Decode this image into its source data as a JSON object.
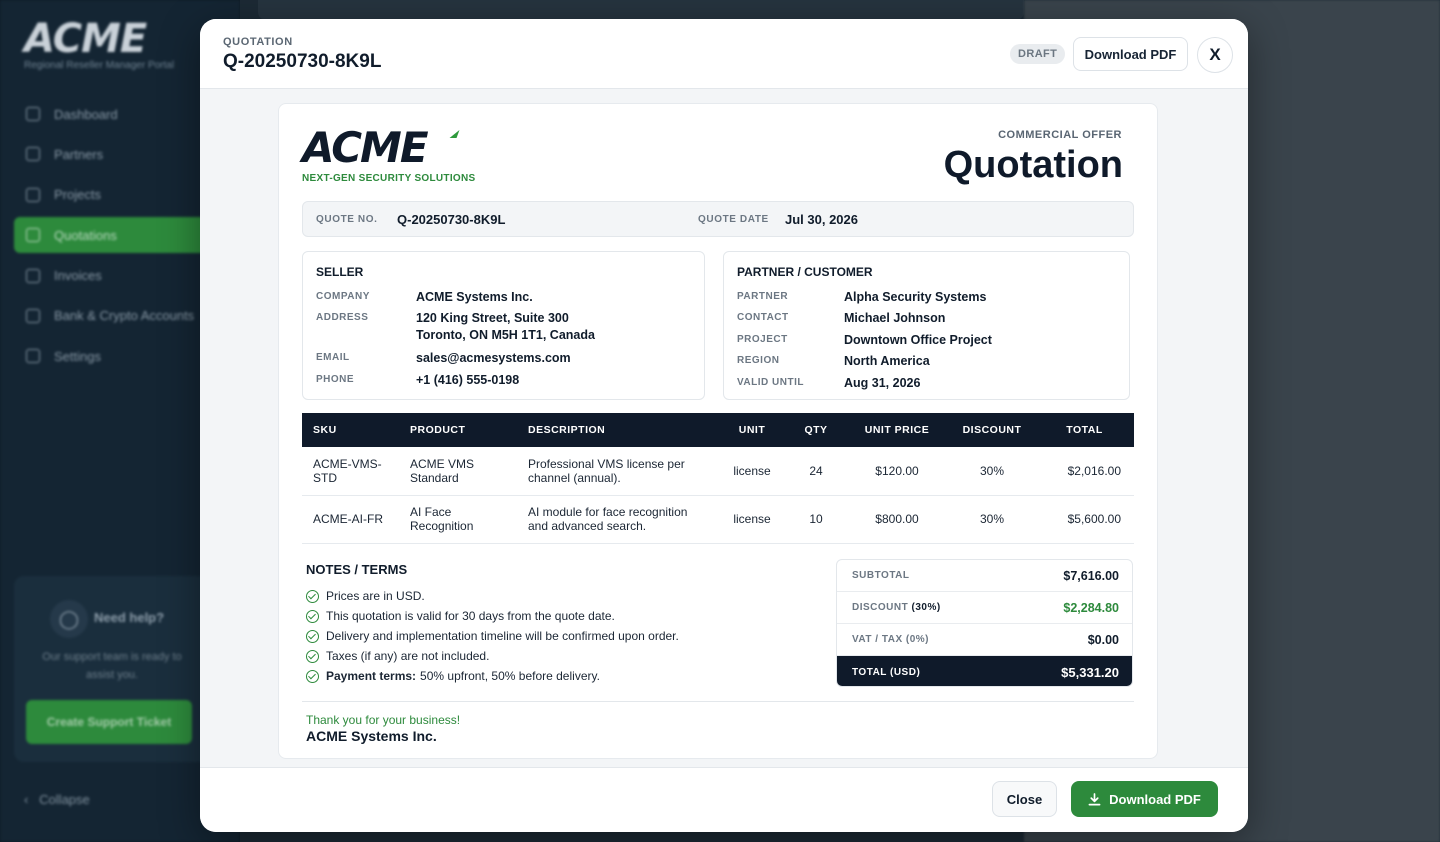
{
  "app": {
    "brand": "ACME",
    "subtitle": "Regional Reseller Manager Portal",
    "nav": [
      {
        "label": "Dashboard",
        "icon": "home-icon"
      },
      {
        "label": "Partners",
        "icon": "users-icon"
      },
      {
        "label": "Projects",
        "icon": "folder-icon"
      },
      {
        "label": "Quotations",
        "icon": "document-icon",
        "active": true
      },
      {
        "label": "Invoices",
        "icon": "invoice-icon"
      },
      {
        "label": "Bank & Crypto Accounts",
        "icon": "bank-icon"
      },
      {
        "label": "Settings",
        "icon": "gear-icon"
      }
    ],
    "help": {
      "title": "Need help?",
      "text": "Our support team is ready to assist you.",
      "button": "Create Support Ticket"
    },
    "collapse": "Collapse"
  },
  "modal": {
    "kicker": "QUOTATION",
    "title": "Q-20250730-8K9L",
    "status": "DRAFT",
    "download_label": "Download PDF",
    "close_x": "X",
    "footer": {
      "close_label": "Close",
      "download_label": "Download PDF"
    }
  },
  "doc": {
    "brand": "ACME",
    "tagline": "NEXT-GEN SECURITY SOLUTIONS",
    "offer_kicker": "COMMERCIAL OFFER",
    "offer_title": "Quotation",
    "meta": {
      "quote_no_label": "QUOTE NO.",
      "quote_no": "Q-20250730-8K9L",
      "quote_date_label": "QUOTE DATE",
      "quote_date": "Jul 30, 2026"
    },
    "seller": {
      "title": "SELLER",
      "rows": [
        {
          "k": "COMPANY",
          "v": "ACME Systems Inc."
        },
        {
          "k": "ADDRESS",
          "v": "120 King Street, Suite 300",
          "v2": "Toronto, ON M5H 1T1, Canada"
        },
        {
          "k": "EMAIL",
          "v": "sales@acmesystems.com"
        },
        {
          "k": "PHONE",
          "v": "+1 (416) 555-0198"
        }
      ]
    },
    "customer": {
      "title": "PARTNER / CUSTOMER",
      "rows": [
        {
          "k": "PARTNER",
          "v": "Alpha Security Systems"
        },
        {
          "k": "CONTACT",
          "v": "Michael Johnson"
        },
        {
          "k": "PROJECT",
          "v": "Downtown Office Project"
        },
        {
          "k": "REGION",
          "v": "North America"
        },
        {
          "k": "VALID UNTIL",
          "v": "Aug 31, 2026"
        }
      ]
    },
    "table": {
      "headers": [
        "SKU",
        "PRODUCT",
        "DESCRIPTION",
        "UNIT",
        "QTY",
        "UNIT PRICE",
        "DISCOUNT",
        "TOTAL"
      ],
      "rows": [
        {
          "sku": "ACME-VMS-STD",
          "product": "ACME VMS Standard",
          "description": "Professional VMS license per channel (annual).",
          "unit": "license",
          "qty": "24",
          "unit_price": "$120.00",
          "discount": "30%",
          "total": "$2,016.00"
        },
        {
          "sku": "ACME-AI-FR",
          "product": "AI Face Recognition",
          "description": "AI module for face recognition and advanced search.",
          "unit": "license",
          "qty": "10",
          "unit_price": "$800.00",
          "discount": "30%",
          "total": "$5,600.00"
        }
      ]
    },
    "notes": {
      "title": "NOTES / TERMS",
      "items": [
        "Prices are in USD.",
        "This quotation is valid for 30 days from the quote date.",
        "Delivery and implementation timeline will be confirmed upon order.",
        "Taxes (if any) are not included."
      ],
      "payment_label": "Payment terms:",
      "payment_text": "50% upfront, 50% before delivery."
    },
    "totals": {
      "subtotal_label": "SUBTOTAL",
      "subtotal": "$7,616.00",
      "discount_label": "DISCOUNT",
      "discount_pct": "(30%)",
      "discount": "$2,284.80",
      "vat_label": "VAT / TAX (0%)",
      "vat": "$0.00",
      "total_label": "TOTAL (USD)",
      "total": "$5,331.20"
    },
    "thanks": "Thank you for your business!",
    "signer": "ACME Systems Inc."
  },
  "colors": {
    "accent_green": "#2d8a3c",
    "navy": "#0f1a2a"
  }
}
